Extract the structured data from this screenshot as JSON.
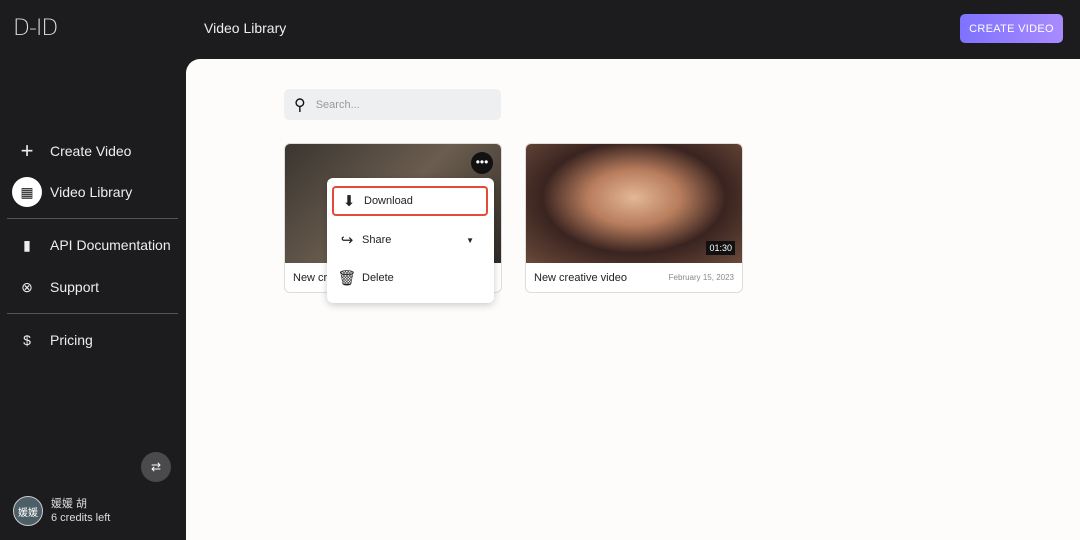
{
  "brand": {
    "logo": "D-ID"
  },
  "header": {
    "title": "Video Library",
    "create_label": "CREATE VIDEO"
  },
  "sidebar": {
    "items": [
      {
        "label": "Create Video",
        "icon": "plus-icon"
      },
      {
        "label": "Video Library",
        "icon": "grid-icon",
        "active": true
      },
      {
        "label": "API Documentation",
        "icon": "document-icon"
      },
      {
        "label": "Support",
        "icon": "lifebuoy-icon"
      },
      {
        "label": "Pricing",
        "icon": "dollar-icon"
      }
    ],
    "user": {
      "avatar": "媛媛",
      "name": "媛媛 胡",
      "credits": "6 credits left"
    }
  },
  "search": {
    "placeholder": "Search..."
  },
  "videos": [
    {
      "title": "New creative video",
      "date": ""
    },
    {
      "title": "New creative video",
      "date": "February 15, 2023",
      "duration": "01:30"
    }
  ],
  "menu": {
    "items": [
      {
        "label": "Download"
      },
      {
        "label": "Share"
      },
      {
        "label": "Delete"
      }
    ]
  },
  "colors": {
    "accent": "#8b7bff",
    "highlight": "#e24b36"
  }
}
